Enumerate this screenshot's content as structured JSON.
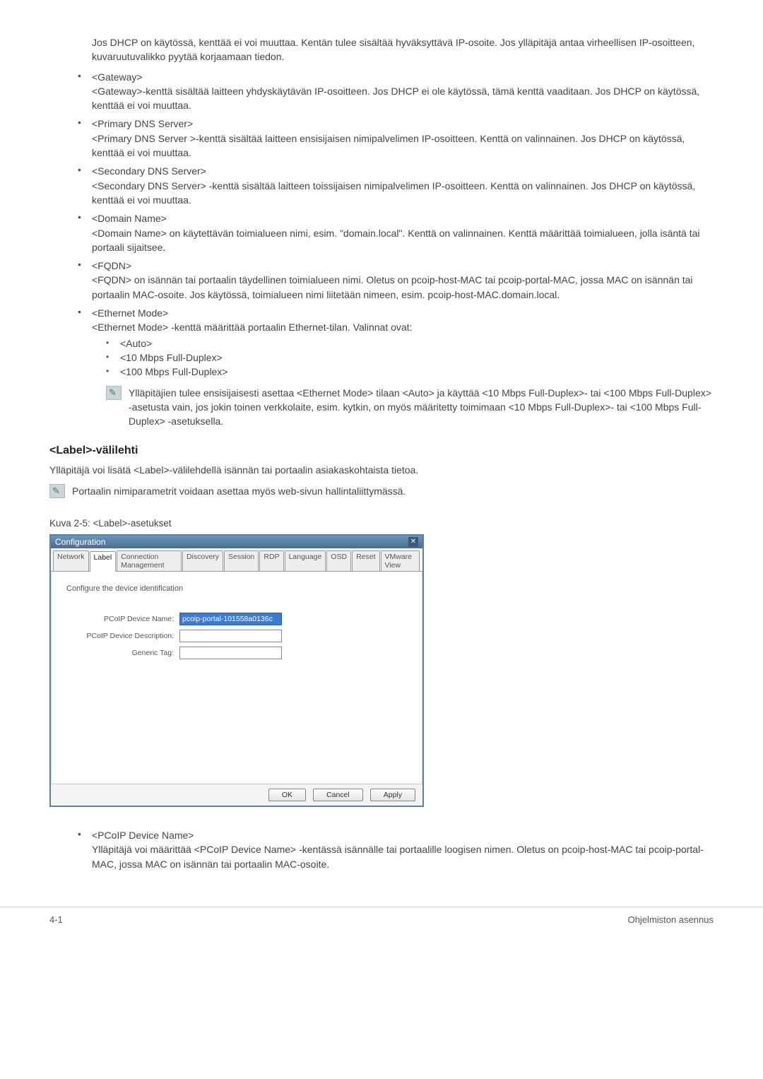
{
  "intro_para": "Jos DHCP on käytössä, kenttää ei voi muuttaa. Kentän tulee sisältää hyväksyttävä IP-osoite. Jos ylläpitäjä antaa virheellisen IP-osoitteen, kuvaruutuvalikko pyytää korjaamaan tiedon.",
  "items": [
    {
      "term": "<Gateway>",
      "desc": "<Gateway>-kenttä sisältää laitteen yhdyskäytävän IP-osoitteen. Jos DHCP ei ole käytössä, tämä kenttä vaaditaan. Jos DHCP on käytössä, kenttää ei voi muuttaa."
    },
    {
      "term": "<Primary DNS Server>",
      "desc": "<Primary DNS Server >-kenttä sisältää laitteen ensisijaisen nimipalvelimen IP-osoitteen. Kenttä on valinnainen. Jos DHCP on käytössä, kenttää ei voi muuttaa."
    },
    {
      "term": "<Secondary DNS Server>",
      "desc": "<Secondary DNS Server> -kenttä sisältää laitteen toissijaisen nimipalvelimen IP-osoitteen. Kenttä on valinnainen. Jos DHCP on käytössä, kenttää ei voi muuttaa."
    },
    {
      "term": "<Domain Name>",
      "desc": "<Domain Name> on käytettävän toimialueen nimi, esim. \"domain.local\". Kenttä on valinnainen. Kenttä määrittää toimialueen, jolla isäntä tai portaali sijaitsee."
    },
    {
      "term": "<FQDN>",
      "desc": "<FQDN> on isännän tai portaalin täydellinen toimialueen nimi. Oletus on pcoip-host-MAC tai pcoip-portal-MAC, jossa MAC on isännän tai portaalin MAC-osoite. Jos käytössä, toimialueen nimi liitetään nimeen, esim. pcoip-host-MAC.domain.local."
    }
  ],
  "ethernet": {
    "term": "<Ethernet Mode>",
    "desc": "<Ethernet Mode> -kenttä määrittää portaalin Ethernet-tilan. Valinnat ovat:",
    "options": [
      "<Auto>",
      "<10 Mbps Full-Duplex>",
      "<100 Mbps Full-Duplex>"
    ],
    "note": "Ylläpitäjien tulee ensisijaisesti asettaa <Ethernet Mode> tilaan <Auto> ja käyttää <10 Mbps Full-Duplex>- tai <100 Mbps Full-Duplex> -asetusta vain, jos jokin toinen verkkolaite, esim. kytkin, on myös määritetty toimimaan <10 Mbps Full-Duplex>- tai <100 Mbps Full-Duplex> -asetuksella."
  },
  "label_section": {
    "title": "<Label>-välilehti",
    "para": "Ylläpitäjä voi lisätä <Label>-välilehdellä isännän tai portaalin asiakaskohtaista tietoa.",
    "note": "Portaalin nimiparametrit voidaan asettaa myös web-sivun hallintaliittymässä.",
    "figure_caption": "Kuva 2-5: <Label>-asetukset"
  },
  "dialog": {
    "title": "Configuration",
    "tabs": [
      "Network",
      "Label",
      "Connection Management",
      "Discovery",
      "Session",
      "RDP",
      "Language",
      "OSD",
      "Reset",
      "VMware View"
    ],
    "active_tab": 1,
    "heading": "Configure the device identification",
    "fields": {
      "name_label": "PCoIP Device Name:",
      "name_value": "pcoip-portal-101558a0136c",
      "desc_label": "PCoIP Device Description:",
      "desc_value": "",
      "tag_label": "Generic Tag:",
      "tag_value": ""
    },
    "buttons": {
      "ok": "OK",
      "cancel": "Cancel",
      "apply": "Apply"
    }
  },
  "pcoip_section": {
    "term": "<PCoIP Device Name>",
    "desc": "Ylläpitäjä voi määrittää <PCoIP Device Name> -kentässä isännälle tai portaalille loogisen nimen. Oletus on pcoip-host-MAC tai pcoip-portal-MAC, jossa MAC on isännän tai portaalin MAC-osoite."
  },
  "footer": {
    "left": "4-1",
    "right": "Ohjelmiston asennus"
  }
}
